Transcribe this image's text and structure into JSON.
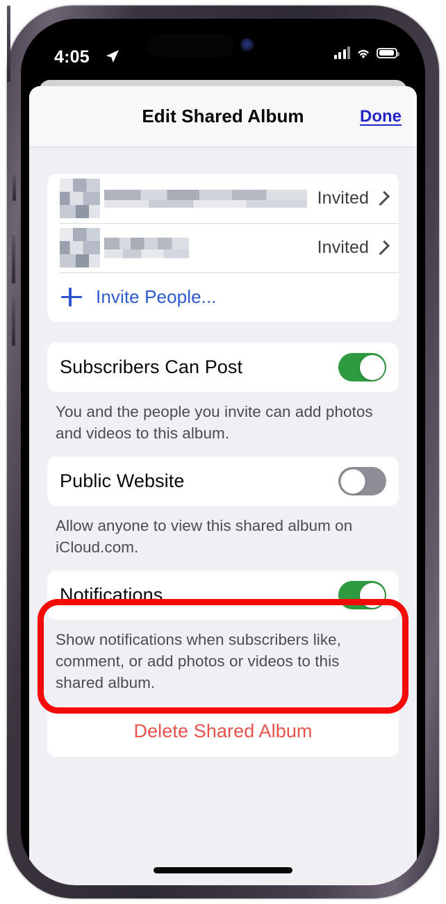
{
  "status_bar": {
    "time": "4:05",
    "location_icon": "location-arrow-icon",
    "cellular_icon": "cellular-bars-icon",
    "wifi_icon": "wifi-icon",
    "battery_icon": "battery-icon"
  },
  "sheet": {
    "title": "Edit Shared Album",
    "done_label": "Done"
  },
  "people_group": {
    "rows": [
      {
        "name_redacted": "",
        "status": "Invited",
        "chevron": "chevron-right-icon"
      },
      {
        "name_redacted": "",
        "status": "Invited",
        "chevron": "chevron-right-icon"
      }
    ],
    "invite_label": "Invite People...",
    "invite_icon": "plus-icon"
  },
  "settings": [
    {
      "label": "Subscribers Can Post",
      "toggle_state": "on",
      "note": "You and the people you invite can add photos and videos to this album."
    },
    {
      "label": "Public Website",
      "toggle_state": "off",
      "note": "Allow anyone to view this shared album on iCloud.com.",
      "highlighted": true
    },
    {
      "label": "Notifications",
      "toggle_state": "on",
      "note": "Show notifications when subscribers like, comment, or add photos or videos to this shared album."
    }
  ],
  "delete": {
    "label": "Delete Shared Album"
  },
  "colors": {
    "accent_blue": "#2d5ad0",
    "done_blue": "#2426c8",
    "toggle_on_green": "#2e9b40",
    "toggle_off_gray": "#8e8e96",
    "destructive_red": "#e8524b",
    "annotation_red": "#f50a0a",
    "group_background": "#efeff4",
    "card_background": "#ffffff"
  }
}
